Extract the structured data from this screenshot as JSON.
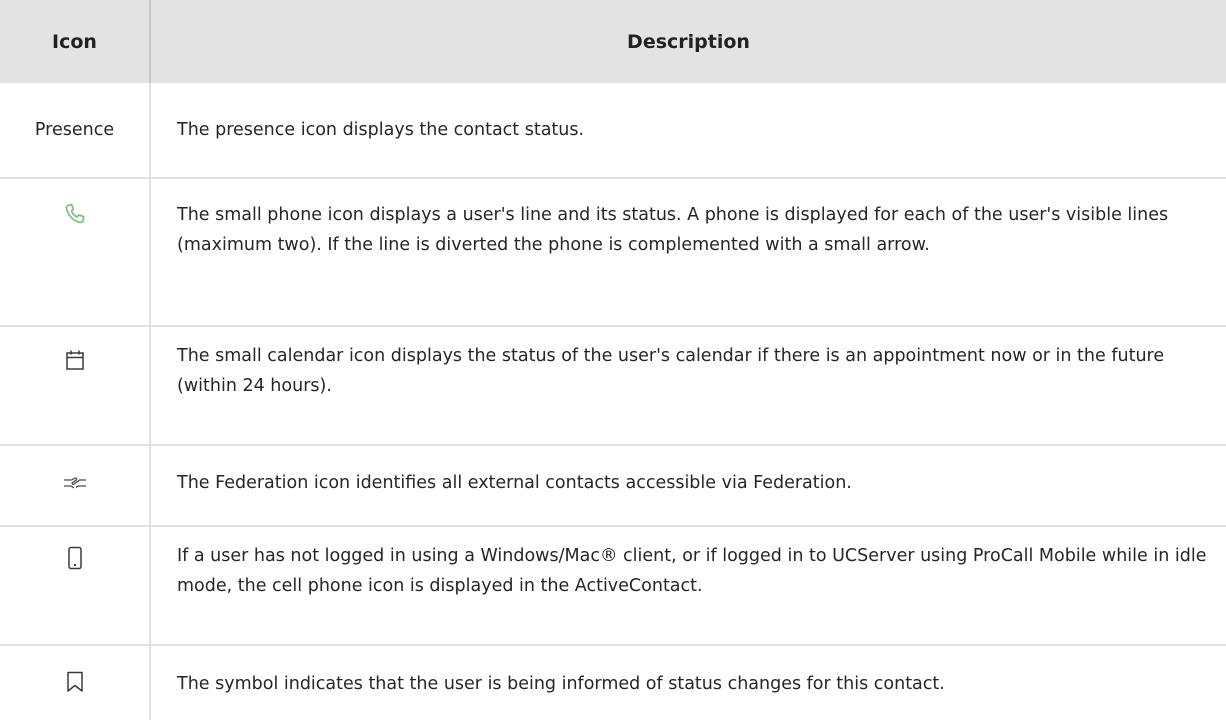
{
  "table": {
    "headers": {
      "icon": "Icon",
      "description": "Description"
    },
    "rows": [
      {
        "icon_label": "Presence",
        "icon": "text-label",
        "description": "The presence icon displays the contact status."
      },
      {
        "icon": "phone-icon",
        "icon_color": "#7cc47c",
        "description": "The small phone icon displays a user's line and its status. A phone is displayed for each of the user's visible lines (maximum two). If the line is diverted the phone is complemented with a small arrow."
      },
      {
        "icon": "calendar-icon",
        "description": "The small calendar icon displays the status of the user's calendar if there is an appointment now or in the future (within 24 hours)."
      },
      {
        "icon": "federation-icon",
        "description": "The Federation icon identifies all external contacts accessible via Federation."
      },
      {
        "icon": "cell-phone-icon",
        "description": "If a user has not logged in using a Windows/Mac® client, or if logged in to UCServer using ProCall Mobile while in idle mode, the cell phone icon is displayed in the ActiveContact."
      },
      {
        "icon": "bookmark-icon",
        "description": "The symbol indicates that the user is being informed of status changes for this contact."
      }
    ]
  },
  "colors": {
    "header_bg": "#e3e3e3",
    "grid_line": "#e1e1e1",
    "text": "#262626",
    "phone_green": "#7cc47c"
  }
}
